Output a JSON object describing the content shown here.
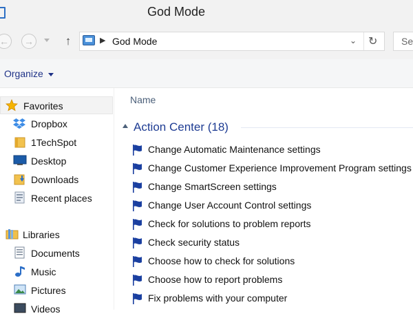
{
  "window": {
    "title": "God Mode"
  },
  "address": {
    "path": "God Mode",
    "search_placeholder": "Sea"
  },
  "commandbar": {
    "organize_label": "Organize"
  },
  "navpane": {
    "favorites_label": "Favorites",
    "favorites": [
      "Dropbox",
      "1TechSpot",
      "Desktop",
      "Downloads",
      "Recent places"
    ],
    "libraries_label": "Libraries",
    "libraries": [
      "Documents",
      "Music",
      "Pictures",
      "Videos"
    ]
  },
  "content": {
    "column_header": "Name",
    "group_title": "Action Center (18)",
    "items": [
      "Change Automatic Maintenance settings",
      "Change Customer Experience Improvement Program settings",
      "Change SmartScreen settings",
      "Change User Account Control settings",
      "Check for solutions to problem reports",
      "Check security status",
      "Choose how to check for solutions",
      "Choose how to report problems",
      "Fix problems with your computer"
    ]
  },
  "icons": {
    "favorites": "star-icon",
    "dropbox": "dropbox-icon",
    "folder": "folder-icon",
    "desktop": "desktop-icon",
    "downloads": "downloads-folder-icon",
    "recent": "recent-places-icon",
    "libraries": "libraries-icon",
    "documents": "documents-icon",
    "music": "music-icon",
    "pictures": "pictures-icon",
    "videos": "videos-icon",
    "item": "action-center-flag-icon"
  },
  "colors": {
    "accent": "#1e3c93",
    "link": "#1e3287",
    "flag": "#1a3fa0"
  }
}
